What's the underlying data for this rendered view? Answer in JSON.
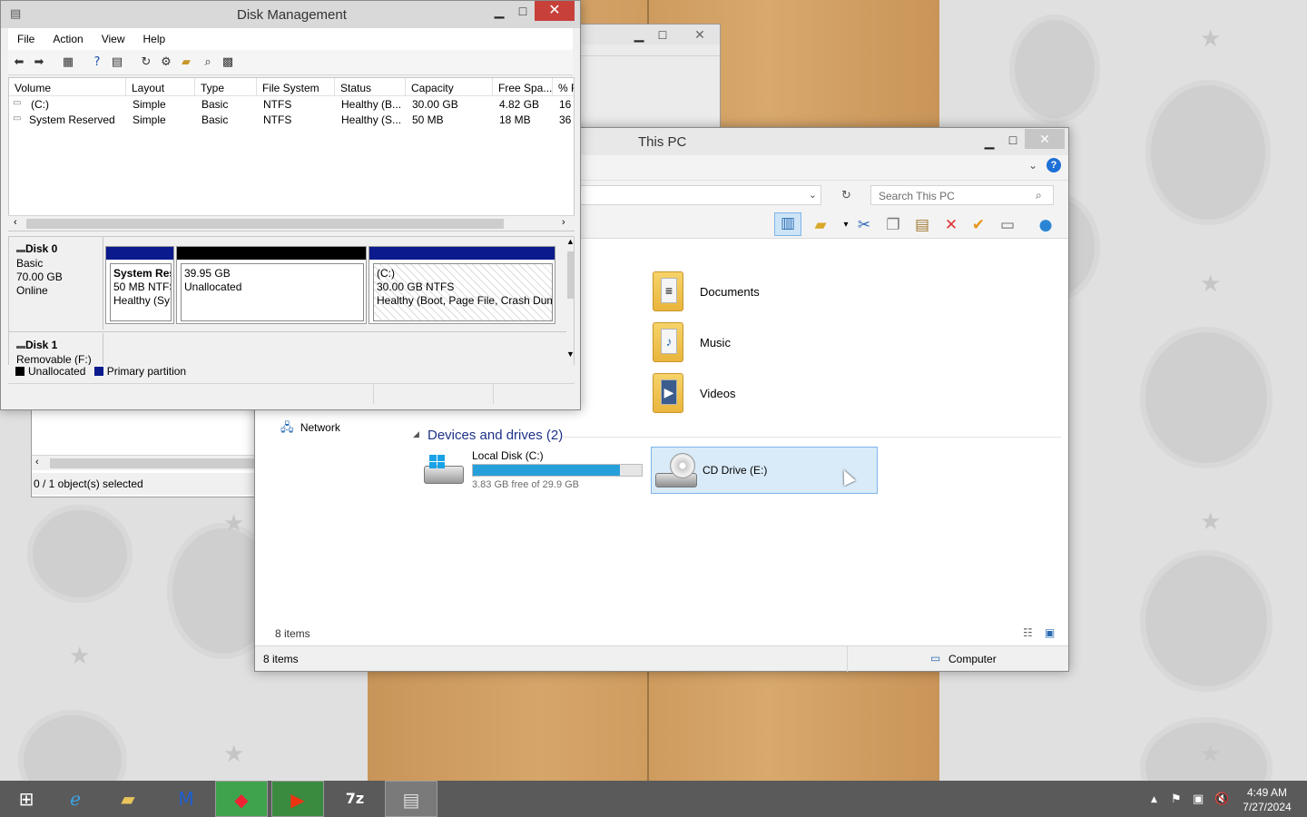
{
  "disk_management": {
    "title": "Disk Management",
    "menu": [
      "File",
      "Action",
      "View",
      "Help"
    ],
    "columns": [
      "Volume",
      "Layout",
      "Type",
      "File System",
      "Status",
      "Capacity",
      "Free Spa...",
      "% F"
    ],
    "volumes": [
      {
        "volume": "(C:)",
        "layout": "Simple",
        "type": "Basic",
        "fs": "NTFS",
        "status": "Healthy (B...",
        "capacity": "30.00 GB",
        "free": "4.82 GB",
        "pct": "16"
      },
      {
        "volume": "System Reserved",
        "layout": "Simple",
        "type": "Basic",
        "fs": "NTFS",
        "status": "Healthy (S...",
        "capacity": "50 MB",
        "free": "18 MB",
        "pct": "36"
      }
    ],
    "disk0": {
      "name": "Disk 0",
      "type": "Basic",
      "size": "70.00 GB",
      "state": "Online",
      "partitions": [
        {
          "line1": "System Res",
          "line2": "50 MB NTFS",
          "line3": "Healthy (Sy"
        },
        {
          "line1": "39.95 GB",
          "line2": "Unallocated",
          "line3": ""
        },
        {
          "line1": "(C:)",
          "line2": "30.00 GB NTFS",
          "line3": "Healthy (Boot, Page File, Crash Dum"
        }
      ]
    },
    "disk1": {
      "name": "Disk 1",
      "type": "Removable (F:)"
    },
    "legend": [
      "Unallocated",
      "Primary partition"
    ]
  },
  "this_pc": {
    "title": "This PC",
    "search_placeholder": "Search This PC",
    "folders": [
      "Documents",
      "Music",
      "Videos"
    ],
    "nav_network": "Network",
    "devices_header": "Devices and drives (2)",
    "drives": [
      {
        "name": "Local Disk (C:)",
        "free_text": "3.83 GB free of 29.9 GB",
        "used_fraction": 0.87
      },
      {
        "name": "CD Drive (E:)"
      }
    ],
    "items_count_inner": "8 items",
    "items_count_status": "8 items",
    "status_location": "Computer"
  },
  "background_window": {
    "selection_status": "0 / 1 object(s) selected"
  },
  "taskbar": {
    "time": "4:49 AM",
    "date": "7/27/2024"
  },
  "colors": {
    "unallocated": "#000000",
    "primary_partition": "#0b1a8c",
    "drive_bar": "#26a0da",
    "close_button": "#c7403a"
  }
}
